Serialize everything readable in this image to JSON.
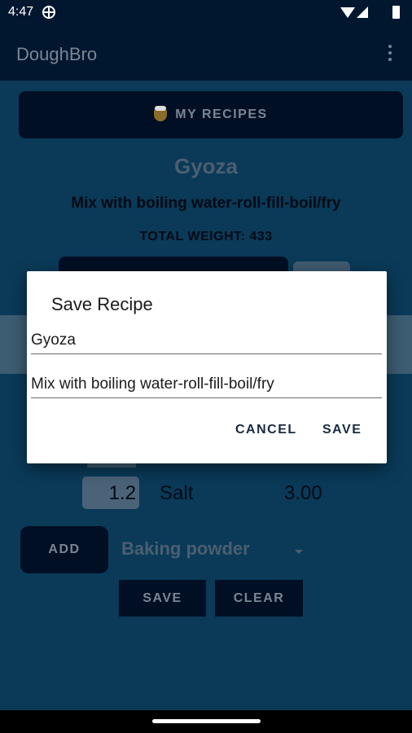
{
  "status_bar": {
    "time": "4:47"
  },
  "app_bar": {
    "title": "DoughBro"
  },
  "main": {
    "my_recipes_label": "MY RECIPES",
    "recipe_title": "Gyoza",
    "recipe_description": "Mix with boiling water-roll-fill-boil/fry",
    "total_weight": "TOTAL WEIGHT: 433",
    "ingredient_row": {
      "quantity": "1.2",
      "name": "Salt",
      "weight": "3.00"
    },
    "add_label": "ADD",
    "ingredient_selected": "Baking powder",
    "save_label": "SAVE",
    "clear_label": "CLEAR"
  },
  "dialog": {
    "title": "Save Recipe",
    "name_value": "Gyoza",
    "description_value": "Mix with boiling water-roll-fill-boil/fry",
    "cancel_label": "CANCEL",
    "save_label": "SAVE"
  },
  "colors": {
    "app_bar": "#01172f",
    "content_dimmed": "#0a3a58",
    "button_dark": "#010f24",
    "dialog_action": "#1a2b3f"
  }
}
